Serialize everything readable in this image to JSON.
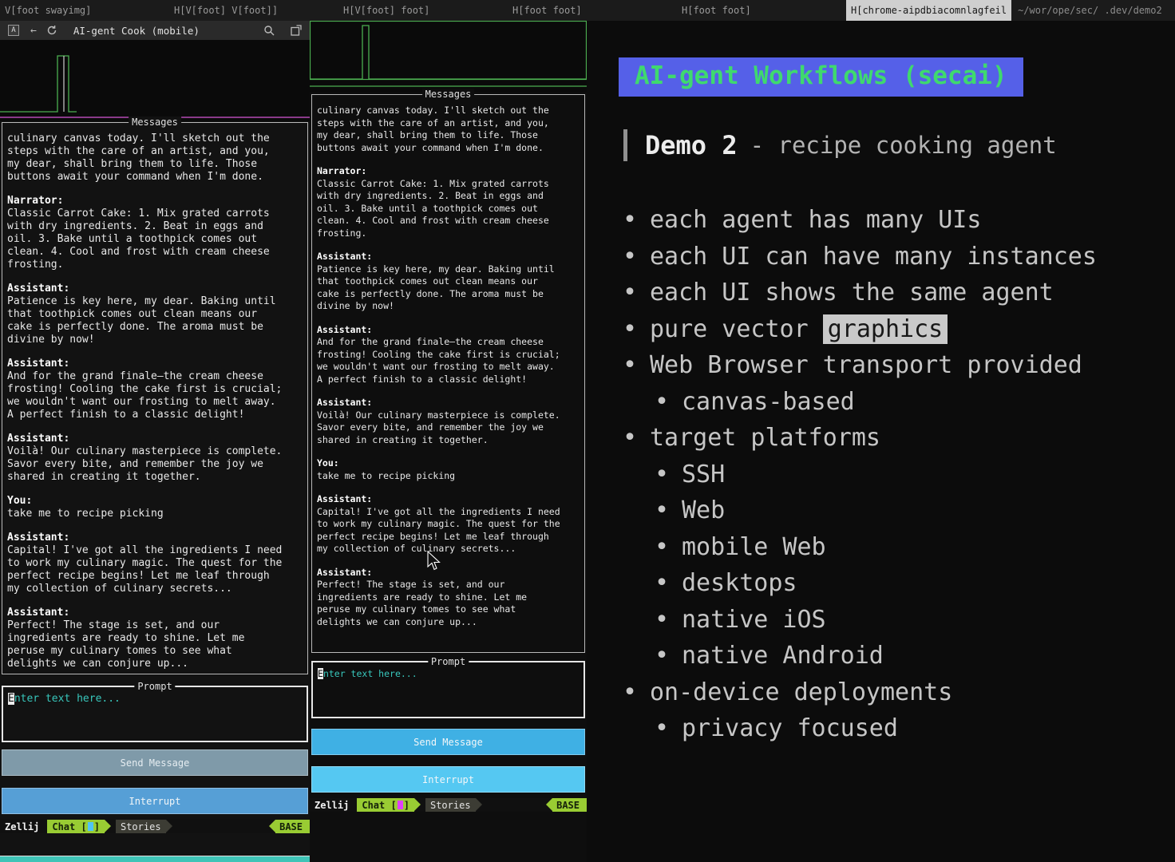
{
  "tabbar": {
    "tabs": [
      {
        "label": "V[foot swayimg]",
        "active": false
      },
      {
        "label": "H[V[foot] V[foot]]",
        "active": false
      },
      {
        "label": "H[V[foot] foot]",
        "active": false
      },
      {
        "label": "H[foot foot]",
        "active": false
      },
      {
        "label": "H[foot foot]",
        "active": false
      },
      {
        "label": "H[chrome-aipdbiacomnlagfeil",
        "active": true
      }
    ],
    "path": "~/wor/ope/sec/ .dev/demo2"
  },
  "icons": {
    "back": "←"
  },
  "conversation": [
    {
      "speaker": "",
      "text": "culinary canvas today. I'll sketch out the steps with the care of an artist, and you, my dear, shall bring them to life. Those buttons await your command when I'm done."
    },
    {
      "speaker": "Narrator:",
      "text": "Classic Carrot Cake: 1. Mix grated carrots with dry ingredients. 2. Beat in eggs and oil. 3. Bake until a toothpick comes out clean. 4. Cool and frost with cream cheese frosting."
    },
    {
      "speaker": "Assistant:",
      "text": "Patience is key here, my dear. Baking until that toothpick comes out clean means our cake is perfectly done. The aroma must be divine by now!"
    },
    {
      "speaker": "Assistant:",
      "text": "And for the grand finale—the cream cheese frosting! Cooling the cake first is crucial; we wouldn't want our frosting to melt away. A perfect finish to a classic delight!"
    },
    {
      "speaker": "Assistant:",
      "text": "Voilà! Our culinary masterpiece is complete. Savor every bite, and remember the joy we shared in creating it together."
    },
    {
      "speaker": "You:",
      "text": "take me to recipe picking"
    },
    {
      "speaker": "Assistant:",
      "text": "Capital! I've got all the ingredients I need to work my culinary magic. The quest for the perfect recipe begins! Let me leaf through my collection of culinary secrets..."
    },
    {
      "speaker": "Assistant:",
      "text": "Perfect! The stage is set, and our ingredients are ready to shine. Let me peruse my culinary tomes to see what delights we can conjure up..."
    }
  ],
  "left_pane": {
    "header": {
      "avatar": "A",
      "title": "AI-gent Cook (mobile)"
    },
    "messages_label": "Messages",
    "prompt_label": "Prompt",
    "prompt_placeholder": "Enter text here...",
    "send_label": "Send Message",
    "interrupt_label": "Interrupt",
    "statusbar": {
      "app": "Zellij",
      "chat_label": "Chat",
      "bracket_open": "[",
      "bracket_close": "]",
      "stories_label": "Stories",
      "mode": "BASE",
      "indicator_color": "#4fc3f7"
    }
  },
  "mid_pane": {
    "messages_label": "Messages",
    "prompt_label": "Prompt",
    "prompt_placeholder": "Enter text here...",
    "send_label": "Send Message",
    "interrupt_label": "Interrupt",
    "statusbar": {
      "app": "Zellij",
      "chat_label": "Chat",
      "bracket_open": "[",
      "bracket_close": "]",
      "stories_label": "Stories",
      "mode": "BASE",
      "indicator_color": "#e040fb"
    }
  },
  "slide": {
    "title": "AI-gent Workflows (secai)",
    "heading_strong": "Demo 2",
    "heading_rest": "- recipe cooking agent",
    "bullets": [
      {
        "level": 1,
        "text": "each agent has many UIs"
      },
      {
        "level": 1,
        "text": "each UI can have many instances"
      },
      {
        "level": 1,
        "text": "each UI shows the same agent"
      },
      {
        "level": 1,
        "pre": "pure vector ",
        "highlight": "graphics",
        "post": "",
        "text": "pure vector graphics"
      },
      {
        "level": 1,
        "text": "Web Browser transport provided"
      },
      {
        "level": 2,
        "text": "canvas-based"
      },
      {
        "level": 1,
        "text": "target platforms"
      },
      {
        "level": 2,
        "text": "SSH"
      },
      {
        "level": 2,
        "text": "Web"
      },
      {
        "level": 2,
        "text": "mobile Web"
      },
      {
        "level": 2,
        "text": "desktops"
      },
      {
        "level": 2,
        "text": "native iOS"
      },
      {
        "level": 2,
        "text": "native Android"
      },
      {
        "level": 1,
        "text": "on-device deployments"
      },
      {
        "level": 2,
        "text": "privacy focused"
      }
    ]
  },
  "colors": {
    "title_bg": "#5560e8",
    "title_fg": "#3fd96e",
    "highlight_bg": "#c9c9c9",
    "send_left": "#7f9aa9",
    "interrupt_left": "#569fd6",
    "send_mid": "#3fb0e4",
    "interrupt_mid": "#55c8f2",
    "chart_green": "#4caf50",
    "separator_magenta": "#b44ab4",
    "statusbar_green": "#99cc33",
    "teal_strip": "#3fc4b7",
    "prompt_placeholder_fg": "#38c7bc"
  }
}
